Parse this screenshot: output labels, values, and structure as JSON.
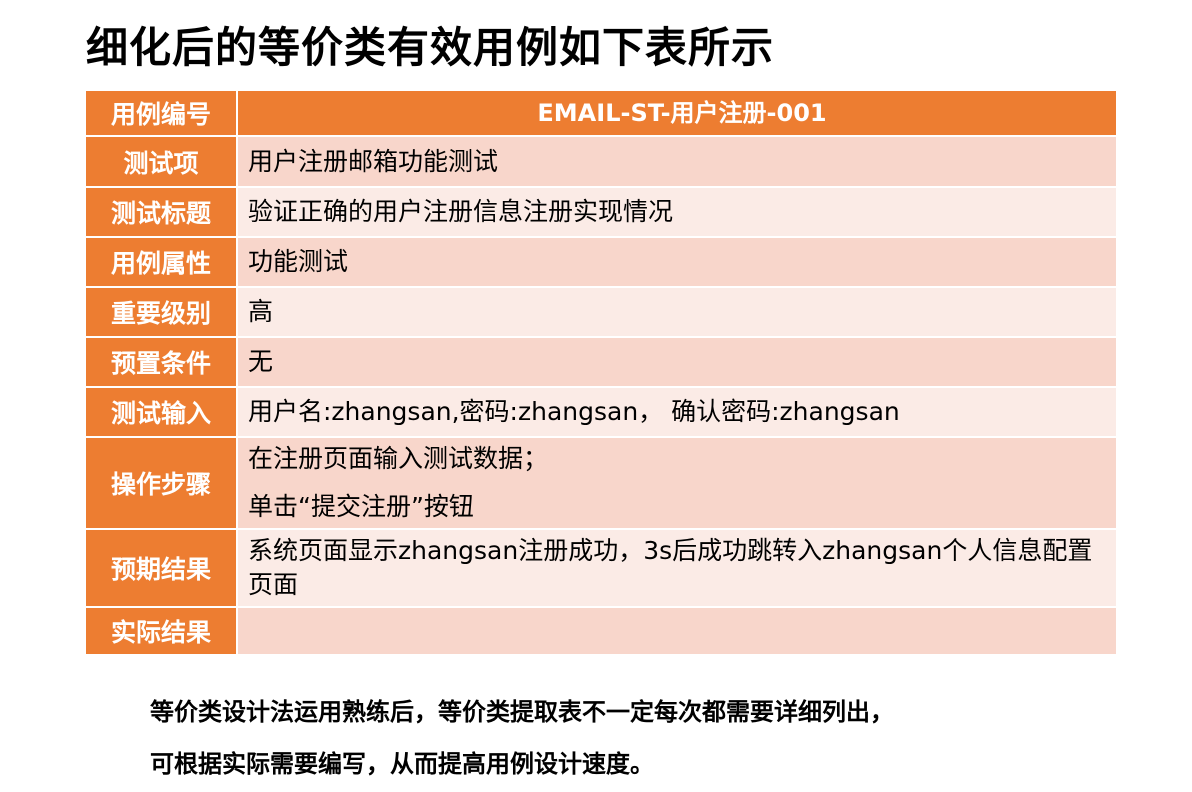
{
  "page": {
    "title": "细化后的等价类有效用例如下表所示"
  },
  "table": {
    "header": {
      "label": "用例编号",
      "value": "EMAIL-ST-用户注册-001"
    },
    "rows": [
      {
        "label": "测试项",
        "value": "用户注册邮箱功能测试"
      },
      {
        "label": "测试标题",
        "value": "验证正确的用户注册信息注册实现情况"
      },
      {
        "label": "用例属性",
        "value": "功能测试"
      },
      {
        "label": "重要级别",
        "value": "高"
      },
      {
        "label": "预置条件",
        "value": "无"
      },
      {
        "label": "测试输入",
        "value": "用户名:zhangsan,密码:zhangsan， 确认密码:zhangsan"
      },
      {
        "label": "操作步骤",
        "lines": [
          "在注册页面输入测试数据；",
          "单击“提交注册”按钮"
        ]
      },
      {
        "label": "预期结果",
        "value": "系统页面显示zhangsan注册成功，3s后成功跳转入zhangsan个人信息配置页面"
      },
      {
        "label": "实际结果",
        "value": ""
      }
    ]
  },
  "footer": {
    "line1": "等价类设计法运用熟练后，等价类提取表不一定每次都需要详细列出，",
    "line2": "可根据实际需要编写，从而提高用例设计速度。"
  },
  "colors": {
    "accent": "#ed7d31",
    "row_odd": "#f8d6cb",
    "row_even": "#fbebe6"
  }
}
